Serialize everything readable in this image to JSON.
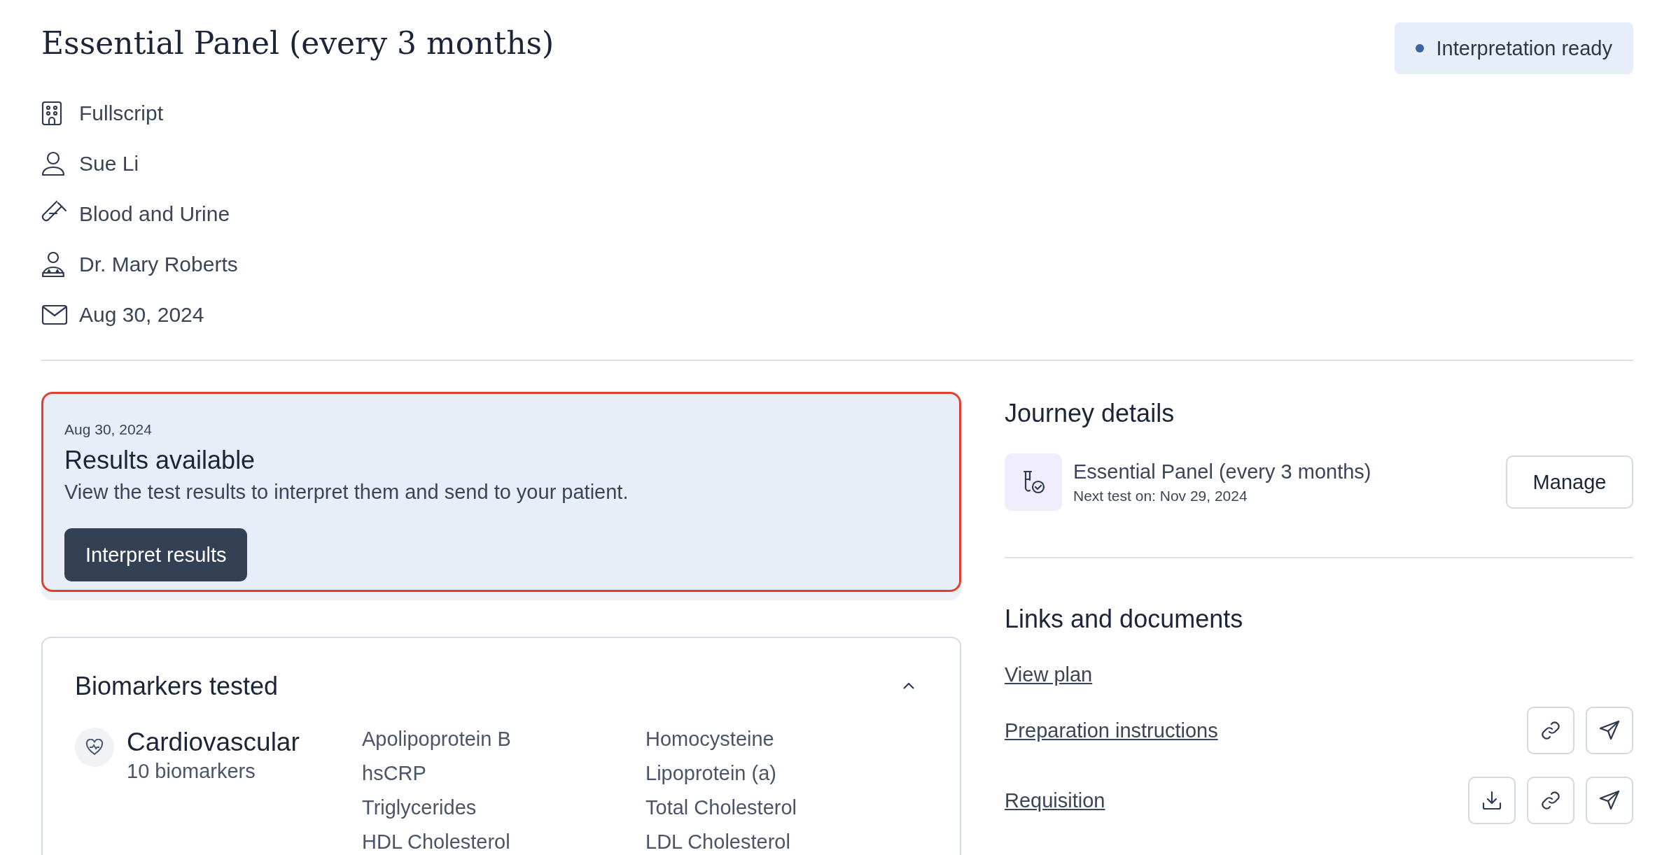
{
  "header": {
    "title": "Essential Panel (every 3 months)",
    "status": {
      "label": "Interpretation ready"
    }
  },
  "details": [
    {
      "kind": "clinic",
      "text": "Fullscript"
    },
    {
      "kind": "patient",
      "text": "Sue Li"
    },
    {
      "kind": "sample",
      "text": "Blood and Urine"
    },
    {
      "kind": "practitioner",
      "text": "Dr. Mary Roberts"
    },
    {
      "kind": "date",
      "text": "Aug 30, 2024"
    }
  ],
  "results_card": {
    "highlighted": true,
    "date": "Aug 30, 2024",
    "title": "Results available",
    "description": "View the test results to interpret them and send to your patient.",
    "button": "Interpret results"
  },
  "biomarkers": {
    "title": "Biomarkers tested",
    "expanded": true,
    "categories": [
      {
        "name": "Cardiovascular",
        "count": "10 biomarkers",
        "items": [
          "Apolipoprotein B",
          "hsCRP",
          "Triglycerides",
          "HDL Cholesterol",
          "Homocysteine",
          "Lipoprotein (a)",
          "Total Cholesterol",
          "LDL Cholesterol"
        ]
      }
    ]
  },
  "journey_details": {
    "title": "Journey details",
    "plan": {
      "name": "Essential Panel (every 3 months)",
      "next_test": "Next test on: Nov 29, 2024"
    },
    "button": "Manage"
  },
  "links_and_documents": {
    "title": "Links and documents",
    "links": [
      {
        "label": "View plan"
      },
      {
        "label": "Preparation instructions",
        "actions": [
          {
            "kind": "copy-link"
          },
          {
            "kind": "send"
          }
        ]
      },
      {
        "label": "Requisition",
        "actions": [
          {
            "kind": "download"
          },
          {
            "kind": "copy-link"
          },
          {
            "kind": "send"
          }
        ]
      }
    ]
  }
}
